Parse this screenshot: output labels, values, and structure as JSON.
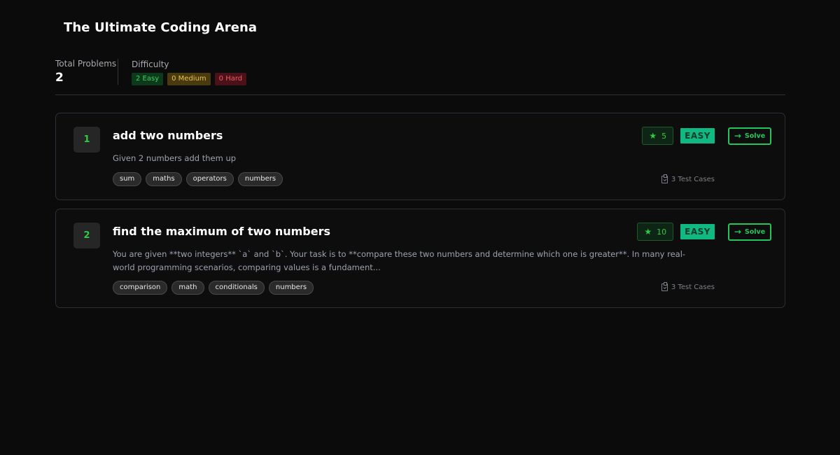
{
  "header": {
    "title": "The Ultimate Coding Arena"
  },
  "stats": {
    "total_label": "Total Problems",
    "total_value": "2",
    "difficulty_label": "Difficulty",
    "easy": "2 Easy",
    "medium": "0 Medium",
    "hard": "0 Hard"
  },
  "problems": [
    {
      "number": "1",
      "title": "add two numbers",
      "description": "Given 2 numbers add them up",
      "tags": [
        "sum",
        "maths",
        "operators",
        "numbers"
      ],
      "test_cases": "3 Test Cases",
      "points": "5",
      "difficulty": "EASY",
      "solve_label": "Solve"
    },
    {
      "number": "2",
      "title": "find the maximum of two numbers",
      "description": "You are given **two integers** `a` and `b`. Your task is to **compare these two numbers and determine which one is greater**. In many real-world programming scenarios, comparing values is a fundament...",
      "tags": [
        "comparison",
        "math",
        "conditionals",
        "numbers"
      ],
      "test_cases": "3 Test Cases",
      "points": "10",
      "difficulty": "EASY",
      "solve_label": "Solve"
    }
  ],
  "icons": {
    "star": "star-icon",
    "arrow": "arrow-right-icon",
    "test_cases": "clipboard-check-icon"
  },
  "colors": {
    "accent": "#22c55e",
    "easy_badge": "#10b981",
    "background": "#0b0b0b"
  }
}
